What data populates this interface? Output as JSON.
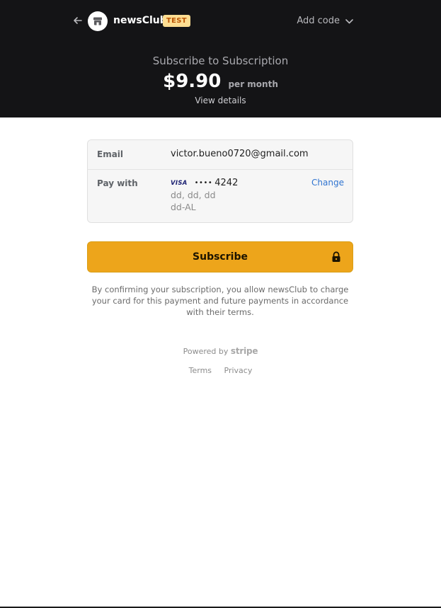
{
  "header": {
    "merchant_name": "newsClub",
    "test_badge": "TEST",
    "add_code_label": "Add code",
    "summary_title": "Subscribe to Subscription",
    "price": "$9.90",
    "interval": "per month",
    "view_details": "View details"
  },
  "info_card": {
    "email_label": "Email",
    "email_value": "victor.bueno0720@gmail.com",
    "pay_label": "Pay with",
    "card_brand": "VISA",
    "card_mask": "••••",
    "card_last4": "4242",
    "address_line1": "dd, dd, dd",
    "address_line2": "dd-AL",
    "change_label": "Change"
  },
  "subscribe_button": {
    "label": "Subscribe"
  },
  "terms": {
    "text": "By confirming your subscription, you allow newsClub to charge your card for this payment and future payments in accordance with their terms."
  },
  "footer": {
    "powered_by": "Powered by",
    "stripe": "stripe",
    "terms_link": "Terms",
    "privacy_link": "Privacy"
  },
  "colors": {
    "header_bg": "#141416",
    "button_bg": "#eda51b",
    "test_badge_bg": "#ffde92",
    "link": "#2f74d0"
  },
  "icons": [
    "back-arrow-icon",
    "store-icon",
    "chevron-down-icon",
    "lock-icon"
  ]
}
